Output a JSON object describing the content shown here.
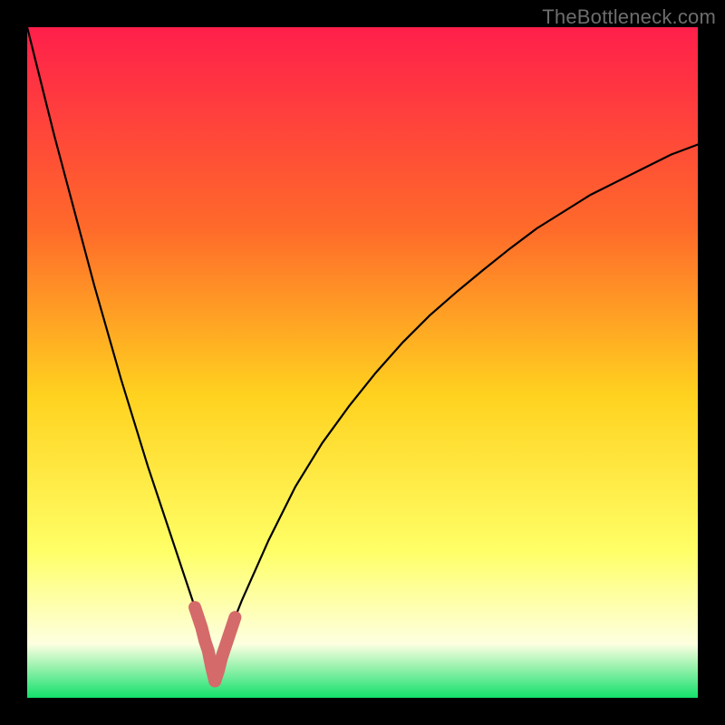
{
  "watermark": {
    "text": "TheBottleneck.com"
  },
  "colors": {
    "gradient_top": "#ff1f4b",
    "gradient_mid1": "#ff6a2a",
    "gradient_mid2": "#ffd21f",
    "gradient_mid3": "#ffff66",
    "gradient_mid4": "#fdffe0",
    "gradient_bottom": "#13e06b",
    "curve": "#000000",
    "overlay_stroke": "#d46a6a",
    "frame": "#000000"
  },
  "chart_data": {
    "type": "line",
    "title": "",
    "xlabel": "",
    "ylabel": "",
    "xlim": [
      0,
      100
    ],
    "ylim": [
      0,
      100
    ],
    "vertex_x": 28,
    "x": [
      0,
      2,
      4,
      6,
      8,
      10,
      12,
      14,
      16,
      18,
      20,
      22,
      24,
      25,
      26,
      27,
      28,
      29,
      30,
      31,
      32,
      34,
      36,
      38,
      40,
      44,
      48,
      52,
      56,
      60,
      64,
      68,
      72,
      76,
      80,
      84,
      88,
      92,
      96,
      100
    ],
    "values": [
      100,
      92,
      84,
      76.5,
      69,
      61.5,
      54.5,
      47.5,
      41,
      34.5,
      28.5,
      22.5,
      16.5,
      13.5,
      10.5,
      7.0,
      2.5,
      6.0,
      9.0,
      12.0,
      14.5,
      19.0,
      23.5,
      27.5,
      31.5,
      38.0,
      43.5,
      48.5,
      53.0,
      57.0,
      60.5,
      63.8,
      67.0,
      70.0,
      72.5,
      75.0,
      77.0,
      79.0,
      81.0,
      82.5
    ],
    "overlay_segment": {
      "x": [
        25,
        25.5,
        26,
        26.5,
        27,
        27.5,
        28,
        28.5,
        29,
        29.5,
        30,
        30.5,
        31
      ],
      "values": [
        13.5,
        12.0,
        10.5,
        8.5,
        7.0,
        4.5,
        2.5,
        4.0,
        6.0,
        7.5,
        9.0,
        10.5,
        12.0
      ]
    }
  }
}
